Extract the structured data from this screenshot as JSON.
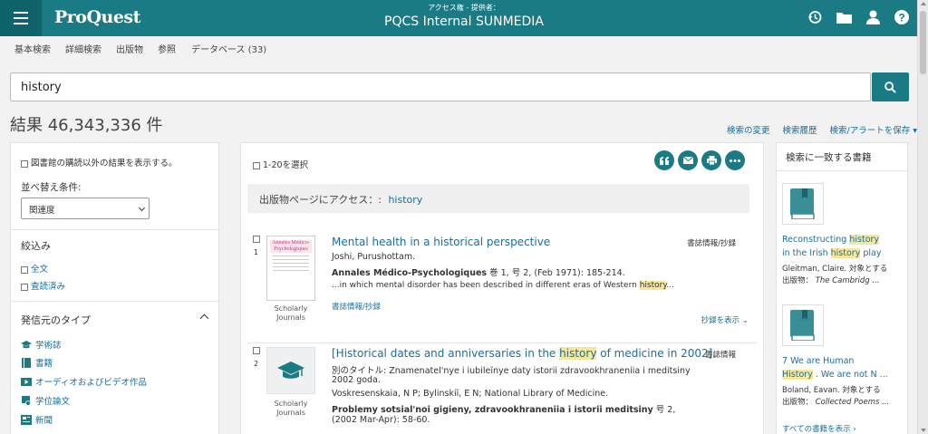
{
  "header": {
    "logo": "ProQuest",
    "account_label": "アクセス権 - 提供者：",
    "account_name": "PQCS Internal SUNMEDIA"
  },
  "nav": [
    "基本検索",
    "詳細検索",
    "出版物",
    "参照",
    "データベース (33)"
  ],
  "search": {
    "query": "history"
  },
  "results": {
    "count": "結果 46,343,336 件",
    "links": [
      "検索の変更",
      "検索履歴",
      "検索/アラートを保存 ▾"
    ]
  },
  "left": {
    "library_option": "図書館の購読以外の結果を表示する。",
    "sort_label": "並べ替え条件:",
    "sort_value": "関連度",
    "filter_title": "絞込み",
    "filter_all": "全文",
    "filter_peer": "査読済み",
    "source_title": "発信元のタイプ",
    "source_types": [
      "学術誌",
      "書籍",
      "オーディオおよびビデオ作品",
      "学位論文",
      "新聞"
    ]
  },
  "main": {
    "select_label": "1-20を選択",
    "pub_access_label": "出版物ページにアクセス：:",
    "pub_access_link": "history",
    "records": [
      {
        "num": "1",
        "title": "Mental health in a historical perspective",
        "format": "書誌情報/抄録",
        "author": "Joshi, Purushottam.",
        "source_bold": "Annales Médico-Psychologiques",
        "source_rest": "巻 1, 号 2, (Feb 1971): 185-214.",
        "snippet_pre": "...in which mental disorder has been described in different eras of Western",
        "snippet_hl": "history",
        "snippet_post": "...",
        "cite_link": "書誌情報/抄録",
        "abstract_link": "抄録を表示 ⌄",
        "thumb_title": "Annales Médico-Psychologiques",
        "thumb_label": "Scholarly Journals"
      },
      {
        "num": "2",
        "title_pre": "[Historical dates and anniversaries in the",
        "title_hl": "history",
        "title_post": "of medicine in 2002].",
        "format": "書誌情報",
        "alt_title": "別のタイトル: Znamenatel'nye i iubileĭnye daty istorii zdravookhraneniia i meditsiny",
        "alt_title2": "2002 goda.",
        "authors": "Voskresenskaia, N P; Bylinskiĭ, E N; National Library of Medicine.",
        "source_bold": "Problemy sotsial'noi gigieny, zdravookhraneniia i istorii meditsiny",
        "source_rest": "号 2,",
        "date": "(2002 Mar-Apr): 58-60.",
        "thumb_label": "Scholarly Journals"
      }
    ]
  },
  "right": {
    "title": "検索に一致する書籍",
    "books": [
      {
        "title_a": "Reconstructing",
        "title_hl1": "history",
        "title_b": "in the Irish",
        "title_hl2": "history",
        "title_c": "play",
        "line1": "Gleitman, Claire. 対象とする",
        "line2_label": "出版物：",
        "line2_value": "The Cambridg ..."
      },
      {
        "title_a": "7 We are Human",
        "title_hl1": "History",
        "title_b": ". We are not N ...",
        "line1": "Boland, Eavan. 対象とする",
        "line2_label": "出版物：",
        "line2_value": "Collected Poems ..."
      }
    ],
    "more": "すべての書籍を表示 ›"
  },
  "colors": {
    "brand": "#1a7b84",
    "link": "#1a6e9c",
    "highlight": "#f7e79a"
  }
}
